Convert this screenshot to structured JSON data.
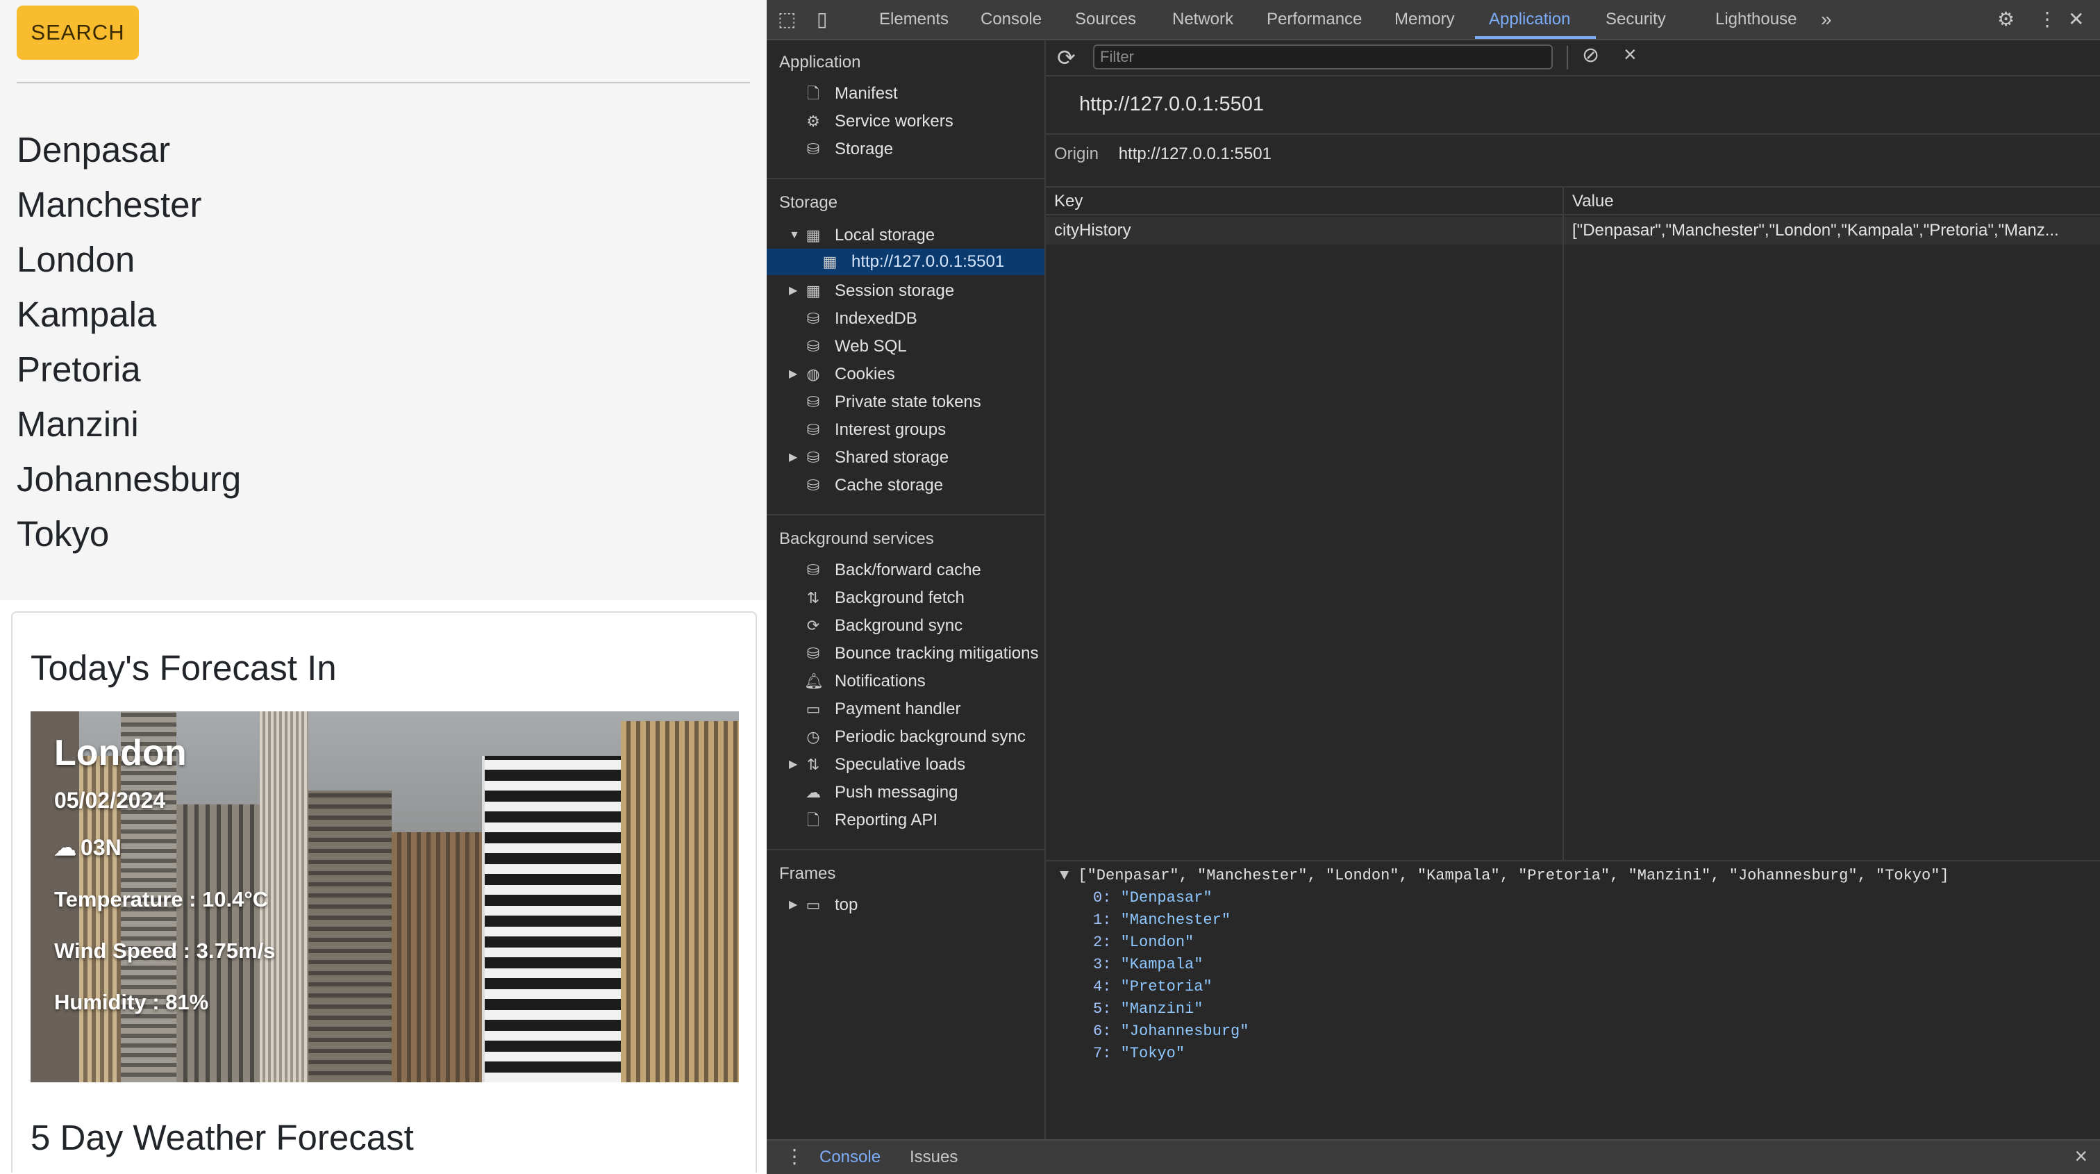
{
  "page": {
    "search_label": "SEARCH",
    "cities": [
      "Denpasar",
      "Manchester",
      "London",
      "Kampala",
      "Pretoria",
      "Manzini",
      "Johannesburg",
      "Tokyo"
    ],
    "forecast_title": "Today's Forecast In",
    "weather": {
      "city": "London",
      "date": "05/02/2024",
      "icon_code": "03N",
      "temperature": "Temperature : 10.4°C",
      "wind": "Wind Speed : 3.75m/s",
      "humidity": "Humidity : 81%"
    },
    "five_day_title": "5 Day Weather Forecast"
  },
  "devtools": {
    "tabs": [
      "Elements",
      "Console",
      "Sources",
      "Network",
      "Performance",
      "Memory",
      "Application",
      "Security",
      "Lighthouse"
    ],
    "active_tab": "Application",
    "sidebar": {
      "application_head": "Application",
      "application_items": [
        "Manifest",
        "Service workers",
        "Storage"
      ],
      "storage_head": "Storage",
      "local_storage": "Local storage",
      "local_storage_origin": "http://127.0.0.1:5501",
      "storage_items": [
        "Session storage",
        "IndexedDB",
        "Web SQL",
        "Cookies",
        "Private state tokens",
        "Interest groups",
        "Shared storage",
        "Cache storage"
      ],
      "background_head": "Background services",
      "background_items": [
        "Back/forward cache",
        "Background fetch",
        "Background sync",
        "Bounce tracking mitigations",
        "Notifications",
        "Payment handler",
        "Periodic background sync",
        "Speculative loads",
        "Push messaging",
        "Reporting API"
      ],
      "frames_head": "Frames",
      "frames_items": [
        "top"
      ]
    },
    "main": {
      "filter_placeholder": "Filter",
      "origin_heading": "http://127.0.0.1:5501",
      "origin_label": "Origin",
      "origin_value": "http://127.0.0.1:5501",
      "columns": [
        "Key",
        "Value"
      ],
      "rows": [
        {
          "key": "cityHistory",
          "value": "[\"Denpasar\",\"Manchester\",\"London\",\"Kampala\",\"Pretoria\",\"Manz..."
        }
      ],
      "preview_summary": "[\"Denpasar\", \"Manchester\", \"London\", \"Kampala\", \"Pretoria\", \"Manzini\", \"Johannesburg\", \"Tokyo\"]",
      "preview_items": [
        "\"Denpasar\"",
        "\"Manchester\"",
        "\"London\"",
        "\"Kampala\"",
        "\"Pretoria\"",
        "\"Manzini\"",
        "\"Johannesburg\"",
        "\"Tokyo\""
      ]
    },
    "drawer": {
      "console": "Console",
      "issues": "Issues"
    },
    "colors": {
      "accent": "#7cacf8",
      "search_button": "#f8bc2e",
      "selected_row": "#0a3a6e"
    }
  }
}
